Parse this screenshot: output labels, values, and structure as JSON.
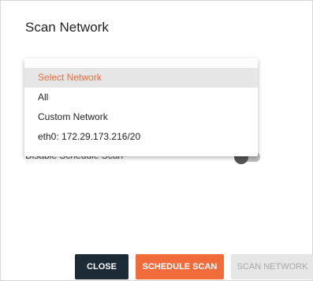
{
  "dialog": {
    "title": "Scan Network",
    "hidden_row_label": "Disable Schedule Scan"
  },
  "dropdown": {
    "items": [
      {
        "label": "Select Network",
        "selected": true
      },
      {
        "label": "All",
        "selected": false
      },
      {
        "label": "Custom Network",
        "selected": false
      },
      {
        "label": "eth0: 172.29.173.216/20",
        "selected": false
      }
    ]
  },
  "buttons": {
    "close": "CLOSE",
    "schedule": "SCHEDULE SCAN",
    "scan": "SCAN NETWORK"
  },
  "colors": {
    "accent": "#f26b3a",
    "dark": "#1d2b36",
    "disabled": "#e6e6e6"
  }
}
